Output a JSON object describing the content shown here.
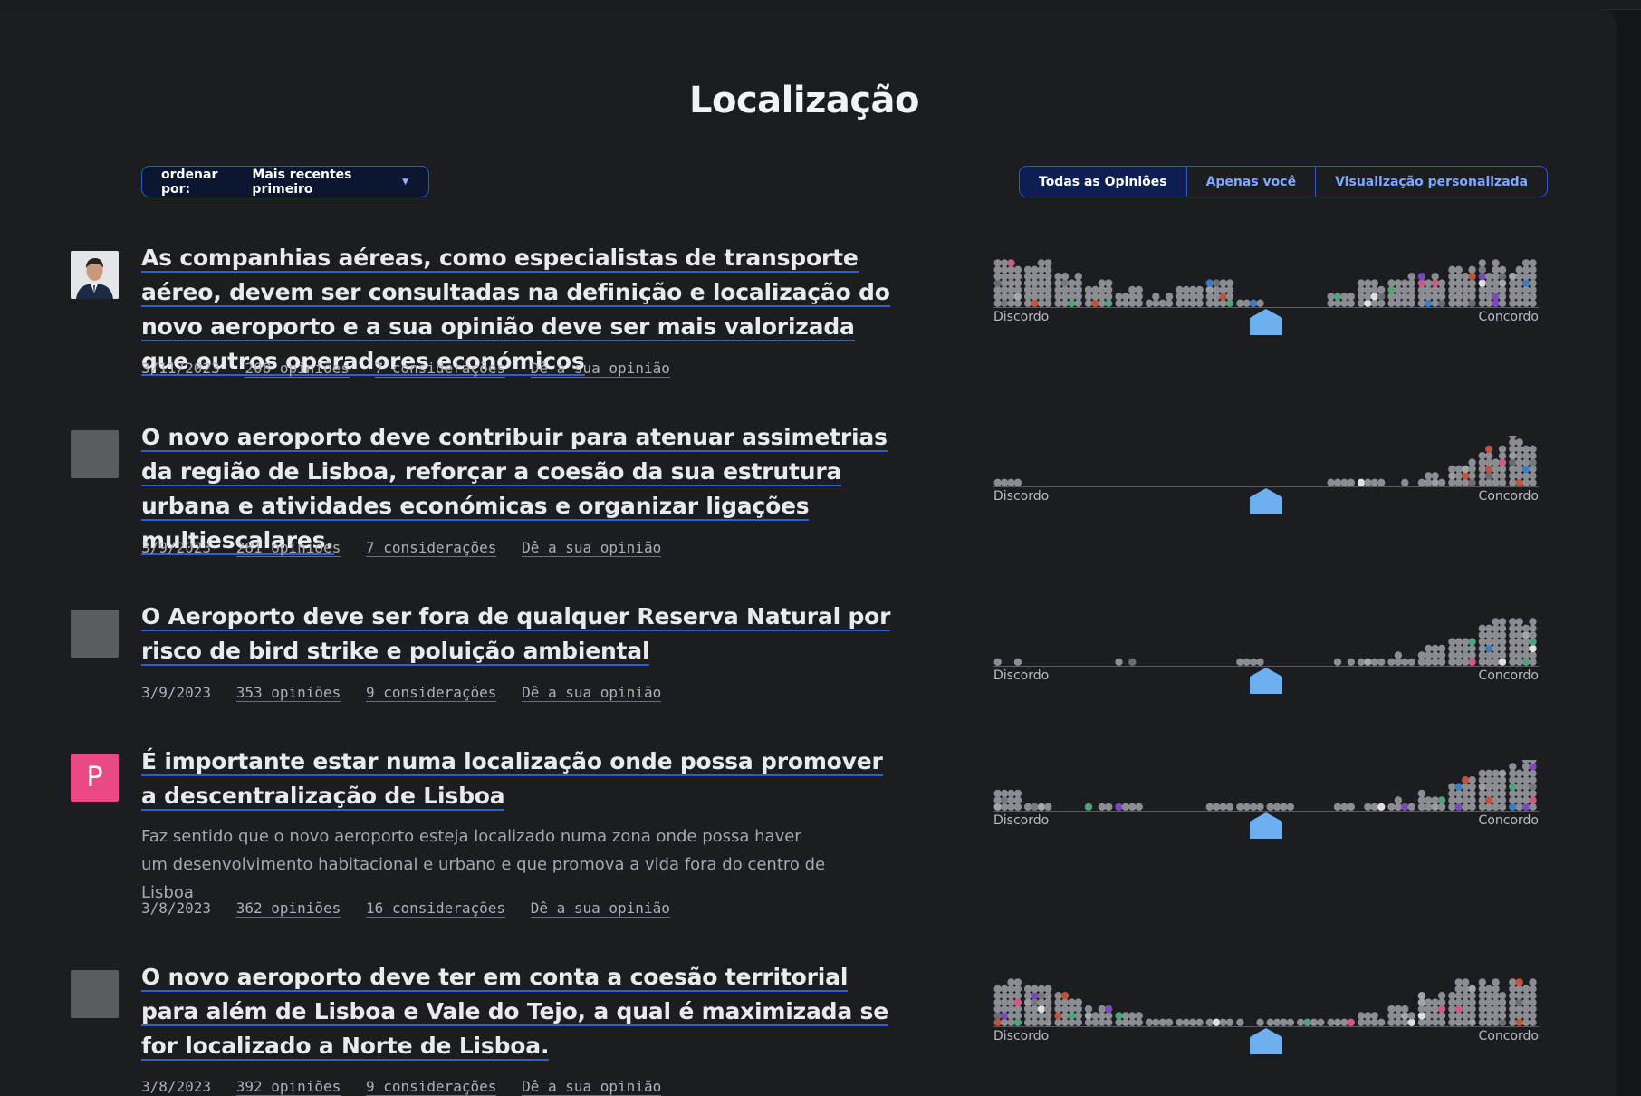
{
  "page": {
    "title": "Localização"
  },
  "controls": {
    "sort_label": "ordenar por:",
    "sort_value": "Mais recentes primeiro",
    "views": [
      "Todas as Opiniões",
      "Apenas você",
      "Visualização personalizada"
    ],
    "active_view": "Todas as Opiniões"
  },
  "chart_labels": {
    "left": "Discordo",
    "right": "Concordo"
  },
  "action_label": "Dê a sua opinião",
  "colors": {
    "accent": "#2f5fd0",
    "marker": "#6eaff0",
    "pink_avatar": "#e94a86"
  },
  "items": [
    {
      "avatar": "photo",
      "question": "As companhias aéreas, como especialistas de transporte aéreo, devem ser consultadas na definição e localização do novo aeroporto e a sua opinião deve ser mais valorizada que outros operadores económicos",
      "description": "",
      "date": "3/11/2023",
      "opinions": "208 opiniões",
      "considerations": "7 considerações",
      "distribution": [
        0.9,
        0.95,
        0.7,
        0.55,
        0.45,
        0.3,
        0.5,
        0.6,
        0.2,
        0.05,
        0.05,
        0.3,
        0.55,
        0.7,
        0.75,
        0.8,
        0.9,
        0.95
      ]
    },
    {
      "avatar": "gray",
      "question": "O novo aeroporto deve contribuir para atenuar assimetrias da região de Lisboa, reforçar a coesão da sua estrutura urbana e atividades económicas e organizar ligações multiescalares.",
      "description": "",
      "date": "3/9/2023",
      "opinions": "281 opiniões",
      "considerations": "7 considerações",
      "distribution": [
        0.2,
        0.05,
        0.05,
        0.1,
        0.1,
        0.05,
        0.05,
        0.05,
        0.1,
        0.05,
        0.1,
        0.2,
        0.15,
        0.15,
        0.25,
        0.5,
        0.8,
        1.0
      ]
    },
    {
      "avatar": "gray",
      "question": "O Aeroporto deve ser fora de qualquer Reserva Natural por risco de bird strike e poluição ambiental",
      "description": "",
      "date": "3/9/2023",
      "opinions": "353 opiniões",
      "considerations": "9 considerações",
      "distribution": [
        0.15,
        0.05,
        0.1,
        0.1,
        0.15,
        0.05,
        0.1,
        0.1,
        0.2,
        0.1,
        0.1,
        0.15,
        0.2,
        0.3,
        0.45,
        0.75,
        0.95,
        1.0
      ]
    },
    {
      "avatar": "pink",
      "avatar_letter": "P",
      "question": "É importante estar numa localização onde possa promover a descentralização de Lisboa",
      "description": "Faz sentido que o novo aeroporto esteja localizado numa zona onde possa haver um desenvolvimento habitacional e urbano e que promova a vida fora do centro de Lisboa",
      "date": "3/8/2023",
      "opinions": "362 opiniões",
      "considerations": "16 considerações",
      "distribution": [
        0.5,
        0.2,
        0.1,
        0.15,
        0.2,
        0.1,
        0.1,
        0.15,
        0.2,
        0.15,
        0.1,
        0.15,
        0.15,
        0.25,
        0.4,
        0.7,
        0.95,
        1.0
      ]
    },
    {
      "avatar": "gray",
      "question": "O novo aeroporto deve ter em conta a coesão territorial para além de Lisboa e Vale do Tejo, a qual é maximizada se for localizado a Norte de Lisboa.",
      "description": "",
      "date": "3/8/2023",
      "opinions": "392 opiniões",
      "considerations": "9 considerações",
      "distribution": [
        1.0,
        0.95,
        0.7,
        0.45,
        0.35,
        0.25,
        0.2,
        0.2,
        0.15,
        0.2,
        0.2,
        0.2,
        0.3,
        0.45,
        0.7,
        0.85,
        0.95,
        1.0
      ]
    }
  ]
}
